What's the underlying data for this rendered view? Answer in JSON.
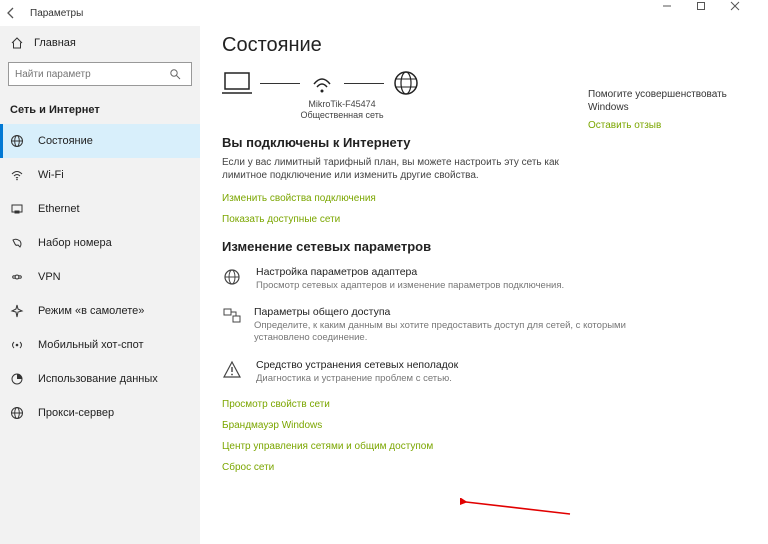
{
  "window": {
    "title": "Параметры"
  },
  "sidebar": {
    "home": "Главная",
    "search_placeholder": "Найти параметр",
    "group": "Сеть и Интернет",
    "items": [
      {
        "label": "Состояние",
        "icon": "status"
      },
      {
        "label": "Wi-Fi",
        "icon": "wifi"
      },
      {
        "label": "Ethernet",
        "icon": "ethernet"
      },
      {
        "label": "Набор номера",
        "icon": "dialup"
      },
      {
        "label": "VPN",
        "icon": "vpn"
      },
      {
        "label": "Режим «в самолете»",
        "icon": "airplane"
      },
      {
        "label": "Мобильный хот-спот",
        "icon": "hotspot"
      },
      {
        "label": "Использование данных",
        "icon": "data"
      },
      {
        "label": "Прокси-сервер",
        "icon": "proxy"
      }
    ]
  },
  "content": {
    "heading": "Состояние",
    "network_name": "MikroTik-F45474",
    "network_type": "Общественная сеть",
    "connected_title": "Вы подключены к Интернету",
    "connected_desc": "Если у вас лимитный тарифный план, вы можете настроить эту сеть как лимитное подключение или изменить другие свойства.",
    "link_change_props": "Изменить свойства подключения",
    "link_show_networks": "Показать доступные сети",
    "advanced_title": "Изменение сетевых параметров",
    "adv": [
      {
        "title": "Настройка параметров адаптера",
        "desc": "Просмотр сетевых адаптеров и изменение параметров подключения."
      },
      {
        "title": "Параметры общего доступа",
        "desc": "Определите, к каким данным вы хотите предоставить доступ для сетей, с которыми установлено соединение."
      },
      {
        "title": "Средство устранения сетевых неполадок",
        "desc": "Диагностика и устранение проблем с сетью."
      }
    ],
    "link_view_props": "Просмотр свойств сети",
    "link_firewall": "Брандмауэр Windows",
    "link_sharing_center": "Центр управления сетями и общим доступом",
    "link_reset": "Сброс сети"
  },
  "right": {
    "title": "Помогите усовершенствовать Windows",
    "link": "Оставить отзыв"
  }
}
